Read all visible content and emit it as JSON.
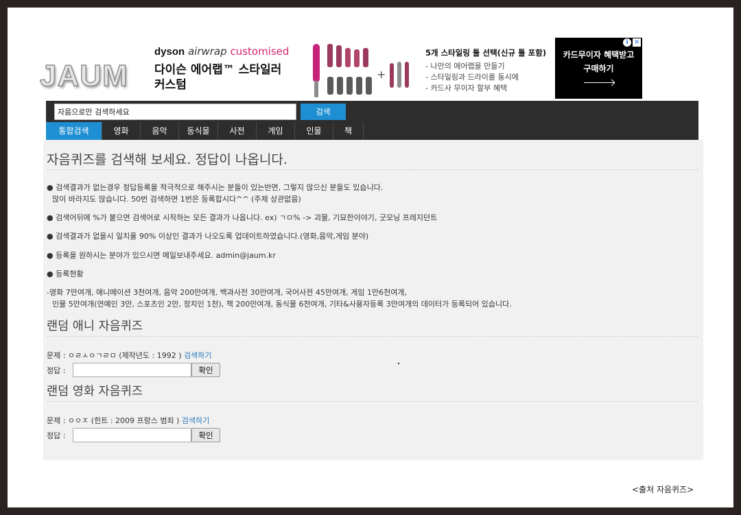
{
  "site": {
    "logo": "JAUM"
  },
  "ad": {
    "brand_dyson": "dyson",
    "brand_airwrap": "airwrap",
    "brand_customised": "customised",
    "title_line1": "다이슨 에어랩™ 스타일러",
    "title_line2": "커스텀",
    "right_title": "5개 스타일링 툴 선택(신규 툴 포함)",
    "bullets": [
      "- 나만의 에어랩을 만들기",
      "- 스타일링과 드라이를 동시에",
      "- 카드사 무이자 할부 혜택"
    ],
    "plus": "+",
    "cta_line1": "카드무이자 혜택받고",
    "cta_line2": "구매하기",
    "info_icon": "i",
    "close_icon": "✕",
    "colors": {
      "fuchsia": "#c8237a",
      "nickel": "#8c8c8c",
      "cta_bg": "#000000"
    }
  },
  "search": {
    "placeholder": "자음으로만 검색하세요",
    "value": "자음으로만 검색하세요",
    "button": "검색"
  },
  "nav": [
    {
      "label": "통합검색",
      "active": true
    },
    {
      "label": "영화",
      "active": false
    },
    {
      "label": "음악",
      "active": false
    },
    {
      "label": "동식물",
      "active": false
    },
    {
      "label": "사전",
      "active": false
    },
    {
      "label": "게임",
      "active": false
    },
    {
      "label": "인물",
      "active": false
    },
    {
      "label": "책",
      "active": false
    }
  ],
  "main": {
    "heading": "자음퀴즈를 검색해 보세요. 정답이 나옵니다.",
    "notes": {
      "n1_line1": "● 검색결과가 없는경우 정답등록을 적극적으로 해주시는 분들이 있는반면, 그렇지 않으신 분들도 있습니다.",
      "n1_line2": "많이 바라지도 않습니다. 50번 검색하면 1번은 등록합시다^^ (주제 상관없음)",
      "n2": "● 검색어뒤에 %가 붙으면 검색어로 시작하는 모든 결과가 나옵니다. ex) ㄱㅁ% -> 괴물, 기묘한이야기, 굿모닝 프레지던트",
      "n3": "● 검색결과가 없을시 일치율 90% 이상인 결과가 나오도록 업데이트하였습니다.(영화,음악,게임 분야)",
      "n4": "● 등록을 원하시는 분야가 있으시면 메일보내주세요. admin@jaum.kr",
      "n5": "● 등록현황",
      "stats_line1": "-영화 7만여개, 애니메이션 3천여개, 음악 200만여개, 백과사전 30만여개, 국어사전 45만여개, 게임 1만6천여개,",
      "stats_line2": "인물 5만여개(연예인 3만, 스포츠인 2만, 정치인 1천), 책 200만여개, 동식물 6천여개, 기타&사용자등록 3만여개의 데이터가 등록되어 있습니다."
    },
    "anime_quiz": {
      "heading": "랜덤 애니 자음퀴즈",
      "question": "문제 : ㅇㄹㅅㅇㄱㄹㅁ (제작년도 : 1992 )",
      "search_link": "검색하기",
      "answer_label": "정답 :",
      "answer_value": "",
      "confirm": "확인"
    },
    "movie_quiz": {
      "heading": "랜덤 영화 자음퀴즈",
      "question": "문제 : ㅇㅇㅈ (힌트 : 2009 프랑스 범죄 )",
      "search_link": "검색하기",
      "answer_label": "정답 :",
      "answer_value": "",
      "confirm": "확인"
    }
  },
  "credit": "<출처 자음퀴즈>"
}
